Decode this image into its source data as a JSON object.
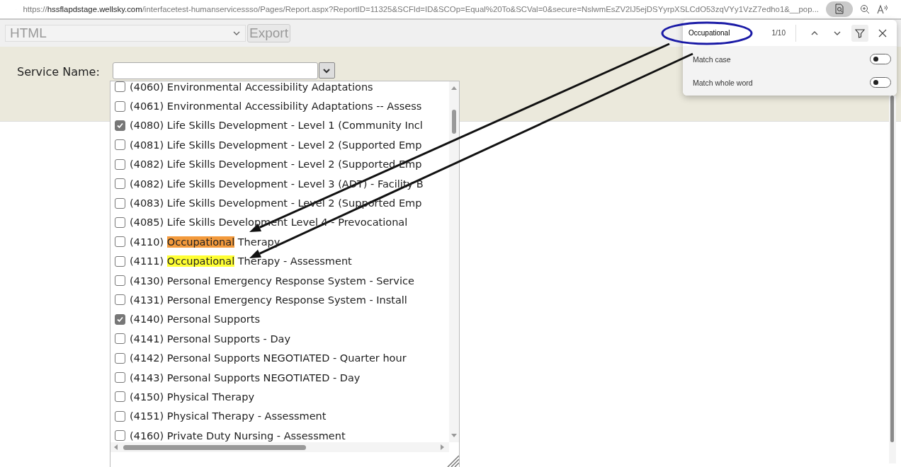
{
  "address_bar": {
    "url": "https://**hssflapdstage.wellsky.com**/interfacetest-humanservicessso/Pages/Report.aspx?ReportID=11325&SCFId=ID&SCOp=Equal%20To&SCVal=0&secure=NslwmEsZV2lJ5ejDSYyrpXSLCdO53zqVYy1VzZ7edho1&__pop...",
    "find_active": true
  },
  "toolbar": {
    "format_select": {
      "value": "HTML",
      "disabled": true
    },
    "export_button": {
      "label": "Export",
      "disabled": true
    }
  },
  "filter": {
    "label": "Service Name:"
  },
  "service_list": {
    "items": [
      {
        "label": "(4060) Environmental Accessibility Adaptations",
        "checked": false
      },
      {
        "label": "(4061) Environmental Accessibility Adaptations -- Assess",
        "checked": false
      },
      {
        "label": "(4080) Life Skills Development - Level 1 (Community Incl",
        "checked": true
      },
      {
        "label": "(4081) Life Skills Development - Level 2 (Supported Emp",
        "checked": false
      },
      {
        "label": "(4082) Life Skills Development - Level 2  (Supported Emp",
        "checked": false
      },
      {
        "label": "(4082) Life Skills Development - Level 3 (ADT) - Facility B",
        "checked": false
      },
      {
        "label": "(4083) Life Skills Development - Level 2 (Supported Emp",
        "checked": false
      },
      {
        "label": "(4085) Life Skills Development Level 4 - Prevocational",
        "checked": false
      },
      {
        "label": "(4110) ",
        "match": "Occupational",
        "after": " Therapy",
        "current": true,
        "checked": false
      },
      {
        "label": "(4111) ",
        "match": "Occupational",
        "after": " Therapy - Assessment",
        "current": false,
        "checked": false
      },
      {
        "label": "(4130) Personal Emergency Response System - Service",
        "checked": false
      },
      {
        "label": "(4131) Personal Emergency Response System - Install",
        "checked": false
      },
      {
        "label": "(4140) Personal Supports",
        "checked": true
      },
      {
        "label": "(4141) Personal Supports - Day",
        "checked": false
      },
      {
        "label": "(4142) Personal Supports NEGOTIATED - Quarter hour",
        "checked": false
      },
      {
        "label": "(4143) Personal Supports NEGOTIATED - Day",
        "checked": false
      },
      {
        "label": "(4150) Physical Therapy",
        "checked": false
      },
      {
        "label": "(4151) Physical Therapy - Assessment",
        "checked": false
      },
      {
        "label": "(4160) Private Duty Nursing - Assessment",
        "checked": false
      }
    ]
  },
  "find_bar": {
    "query": "Occupational",
    "count": "1/10",
    "filter_selected": true,
    "options": [
      {
        "label": "Match case",
        "on": false
      },
      {
        "label": "Match whole word",
        "on": false
      }
    ]
  },
  "annotations": [
    {
      "kind": "ellipse"
    },
    {
      "kind": "arrow"
    },
    {
      "kind": "arrow"
    }
  ]
}
